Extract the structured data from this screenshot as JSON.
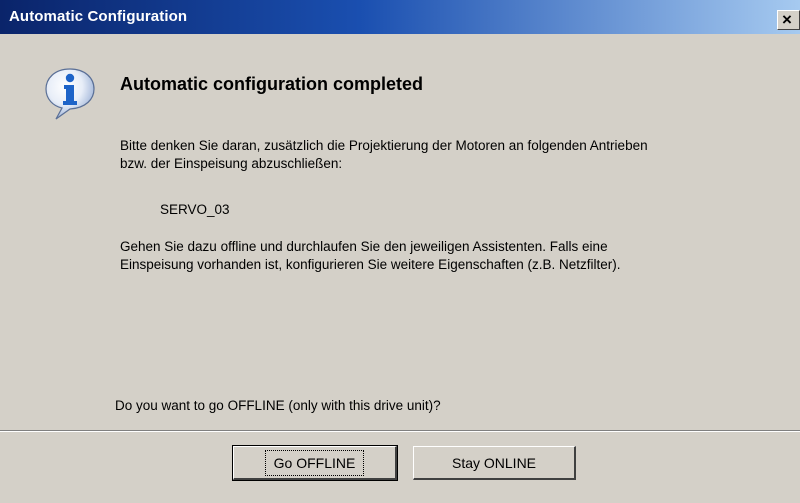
{
  "window": {
    "title": "Automatic Configuration",
    "close_glyph": "×"
  },
  "dialog": {
    "icon": "info-icon",
    "heading": "Automatic configuration completed",
    "message_line1": "Bitte denken Sie daran, zusätzlich die Projektierung der Motoren an folgenden Antrieben",
    "message_line2": "bzw. der Einspeisung abzuschließen:",
    "drive_name": "SERVO_03",
    "message_line3": "Gehen Sie dazu offline und durchlaufen Sie den jeweiligen Assistenten. Falls eine",
    "message_line4": "Einspeisung vorhanden ist, konfigurieren Sie weitere Eigenschaften (z.B. Netzfilter).",
    "question": "Do you want to go OFFLINE (only with this drive unit)?"
  },
  "buttons": {
    "go_offline": "Go OFFLINE",
    "stay_online": "Stay ONLINE"
  },
  "colors": {
    "face": "#d4d0c8",
    "title_start": "#0a246a",
    "title_end": "#a6caf0",
    "icon_blue": "#1e64c8"
  }
}
